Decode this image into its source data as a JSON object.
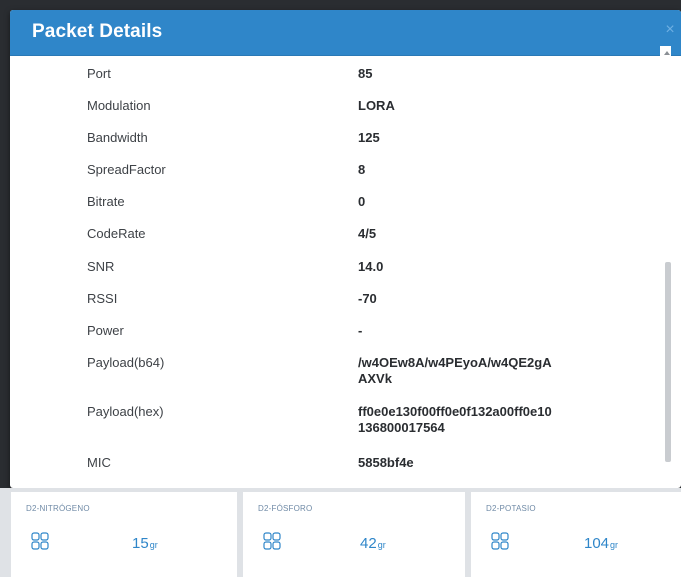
{
  "modal": {
    "title": "Packet Details",
    "close_glyph": "×",
    "fields": [
      {
        "key": "Port",
        "value": "85"
      },
      {
        "key": "Modulation",
        "value": "LORA"
      },
      {
        "key": "Bandwidth",
        "value": "125"
      },
      {
        "key": "SpreadFactor",
        "value": "8"
      },
      {
        "key": "Bitrate",
        "value": "0"
      },
      {
        "key": "CodeRate",
        "value": "4/5"
      },
      {
        "key": "SNR",
        "value": "14.0"
      },
      {
        "key": "RSSI",
        "value": "-70"
      },
      {
        "key": "Power",
        "value": "-"
      },
      {
        "key": "Payload(b64)",
        "value_line1": "/w4OEw8A/w4PEyoA/w4QE2gA",
        "value_line2": "AXVk"
      },
      {
        "key": "Payload(hex)",
        "value_line1": "ff0e0e130f00ff0e0f132a00ff0e10",
        "value_line2": "136800017564"
      },
      {
        "key": "MIC",
        "value": "5858bf4e"
      }
    ]
  },
  "cards": [
    {
      "title": "D2-NITRÓGENO",
      "value": "15",
      "unit": "gr",
      "icon": "grid-icon"
    },
    {
      "title": "D2-FÓSFORO",
      "value": "42",
      "unit": "gr",
      "icon": "grid-icon"
    },
    {
      "title": "D2-POTASIO",
      "value": "104",
      "unit": "gr",
      "icon": "grid-icon"
    }
  ],
  "colors": {
    "header": "#2f86c9",
    "accent": "#2f86c9",
    "card_title": "#6f8aa6",
    "backdrop": "#2a2d31"
  }
}
